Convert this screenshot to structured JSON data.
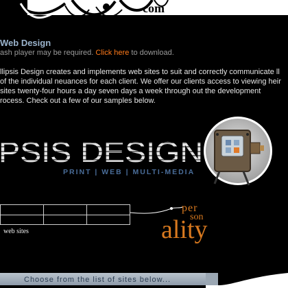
{
  "header": {
    "logo_fragment": "com"
  },
  "content": {
    "title": "Web Design",
    "flash_note_prefix": "ash player may be required.",
    "flash_note_link": "Click here",
    "flash_note_suffix": "to download.",
    "description": "llipsis Design creates and implements web sites to suit and correctly communicate ll of the individual neuances for each client. We offer our clients access to viewing heir sites twenty-four hours a day seven days a week through out the development rocess. Check out a few of our samples below."
  },
  "brand": {
    "wordmark": "PSIS DESIGN",
    "tagline": "PRINT | WEB | MULTI-MEDIA"
  },
  "gallery": {
    "label": "web sites"
  },
  "personality": {
    "line1": "per",
    "line2": "son",
    "line3": "ality"
  },
  "footer": {
    "prompt": "Choose from the list of sites below..."
  },
  "colors": {
    "background": "#000000",
    "title": "#9ab3cc",
    "link": "#ff7a1a",
    "tagline": "#4a6d99",
    "personality": "#d8791f",
    "footer_bar": "#a9b4bf"
  }
}
